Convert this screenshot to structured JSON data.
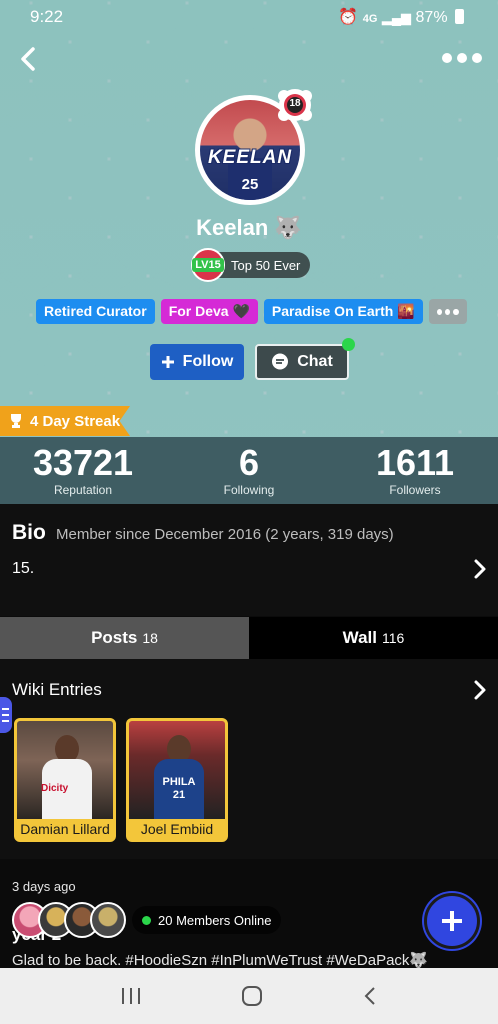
{
  "status_bar": {
    "time": "9:22",
    "network": "4G",
    "battery": "87%"
  },
  "profile": {
    "username": "Keelan 🐺",
    "avatar_text": "KEELAN",
    "avatar_number": "25",
    "level_badge": "LV15",
    "title": "Top 50 Ever",
    "bubble_badge": "18"
  },
  "tags": [
    {
      "label": "Retired Curator",
      "color": "#1d8df0"
    },
    {
      "label": "For Deva 🖤",
      "color": "#d52ad6"
    },
    {
      "label": "Paradise On Earth 🌇",
      "color": "#1d8df0"
    }
  ],
  "actions": {
    "follow": "Follow",
    "chat": "Chat"
  },
  "streak": "4 Day Streak",
  "stats": [
    {
      "value": "33721",
      "label": "Reputation"
    },
    {
      "value": "6",
      "label": "Following"
    },
    {
      "value": "1611",
      "label": "Followers"
    }
  ],
  "bio": {
    "title": "Bio",
    "since": "Member since December 2016 (2 years, 319 days)",
    "text": "15."
  },
  "tabs": [
    {
      "label": "Posts",
      "count": "18"
    },
    {
      "label": "Wall",
      "count": "116"
    }
  ],
  "wiki": {
    "title": "Wiki Entries",
    "entries": [
      {
        "label": "Damian Lillard",
        "jersey": "Dicity"
      },
      {
        "label": "Joel Embiid",
        "jersey": "PHILA 21"
      }
    ]
  },
  "post": {
    "time": "3 days ago",
    "title": "year 2",
    "text": "Glad to be back. #HoodieSzn #InPlumWeTrust #WeDaPack🐺"
  },
  "members_online": "20 Members Online",
  "colors": {
    "accent_blue": "#1d8df0",
    "follow_blue": "#1e5fc4",
    "streak": "#f0a21b",
    "fab": "#3046e0",
    "online": "#2bd64b"
  }
}
